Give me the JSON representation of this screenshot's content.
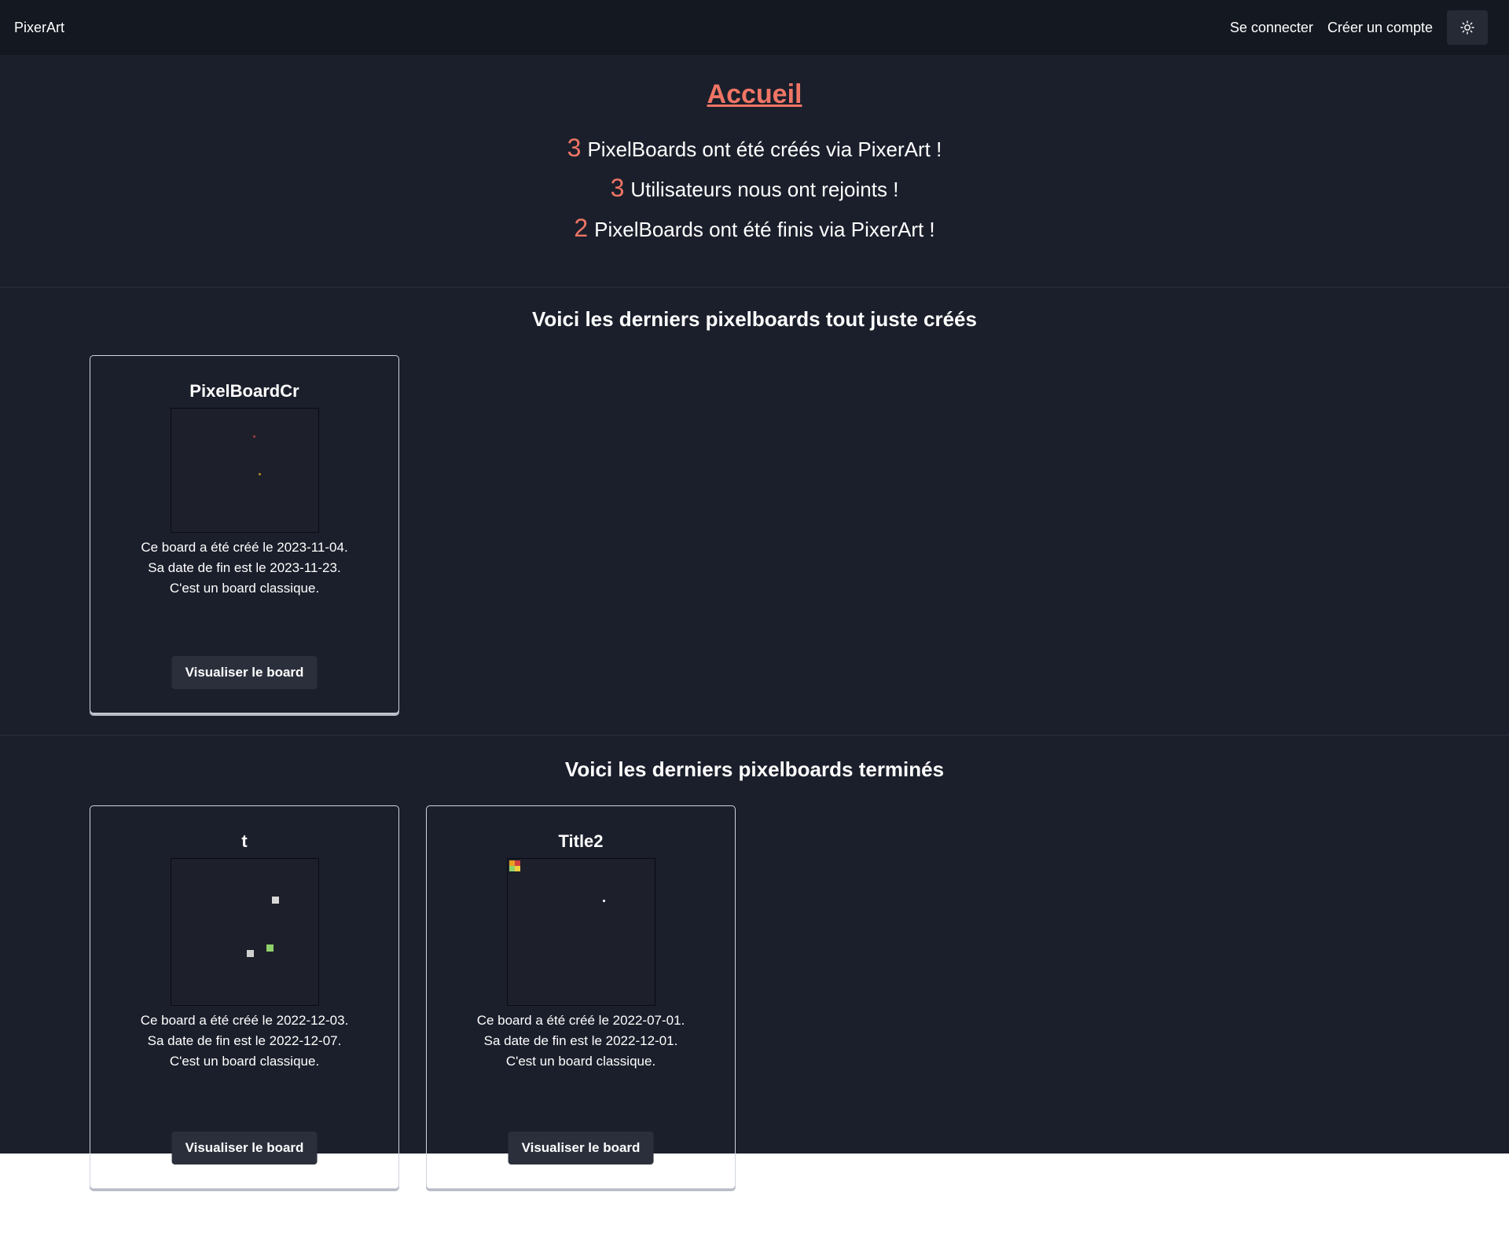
{
  "navbar": {
    "brand": "PixerArt",
    "login_label": "Se connecter",
    "signup_label": "Créer un compte",
    "theme_icon": "sun-icon"
  },
  "hero": {
    "title": "Accueil",
    "stats": [
      {
        "value": "3",
        "text": "PixelBoards ont été créés via PixerArt !"
      },
      {
        "value": "3",
        "text": "Utilisateurs nous ont rejoints !"
      },
      {
        "value": "2",
        "text": "PixelBoards ont été finis via PixerArt !"
      }
    ]
  },
  "recent_created": {
    "title": "Voici les derniers pixelboards tout juste créés",
    "boards": [
      {
        "title": "PixelBoardCr",
        "line1": "Ce board a été créé le 2023-11-04.",
        "line2": "Sa date de fin est le 2023-11-23.",
        "line3": "C'est un board classique.",
        "button": "Visualiser le board"
      }
    ]
  },
  "recent_finished": {
    "title": "Voici les derniers pixelboards terminés",
    "boards": [
      {
        "title": "t",
        "line1": "Ce board a été créé le 2022-12-03.",
        "line2": "Sa date de fin est le 2022-12-07.",
        "line3": "C'est un board classique.",
        "button": "Visualiser le board"
      },
      {
        "title": "Title2",
        "line1": "Ce board a été créé le 2022-07-01.",
        "line2": "Sa date de fin est le 2022-12-01.",
        "line3": "C'est un board classique.",
        "button": "Visualiser le board"
      }
    ]
  },
  "colors": {
    "accent": "#f07565",
    "background": "#1b1f2b",
    "navbar": "#141821"
  }
}
